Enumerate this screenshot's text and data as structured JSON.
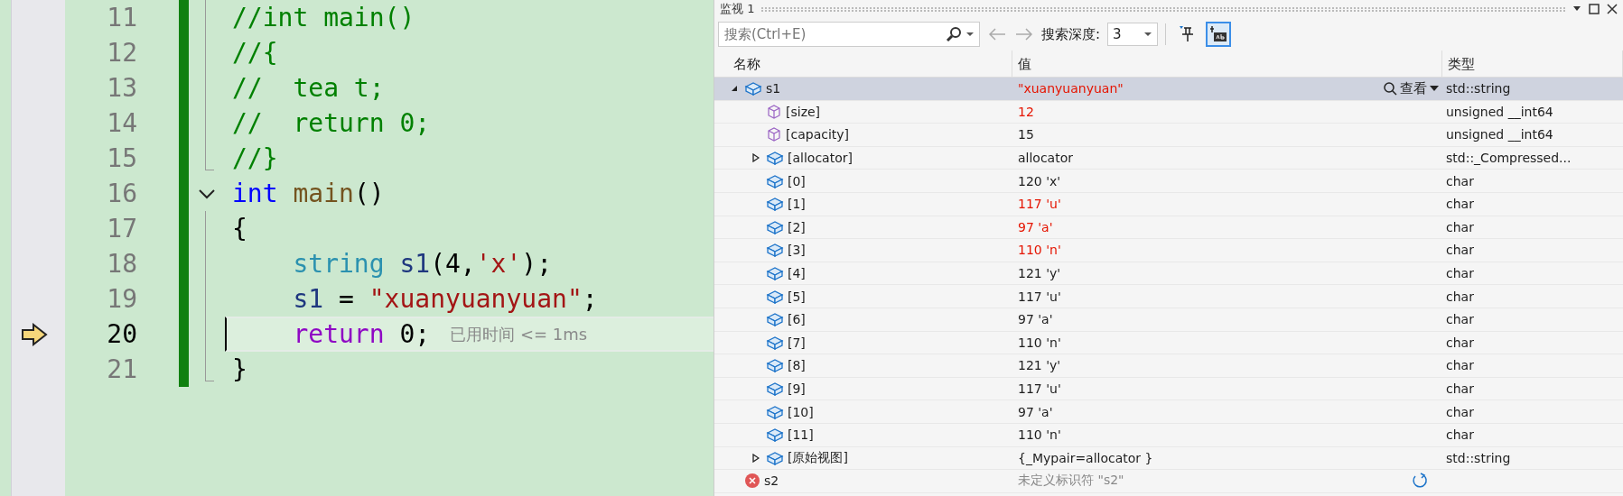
{
  "editor": {
    "lines": [
      {
        "number": "11",
        "current": false,
        "tokens": [
          {
            "kind": "comment",
            "text": "//int main()"
          }
        ]
      },
      {
        "number": "12",
        "current": false,
        "tokens": [
          {
            "kind": "comment",
            "text": "//{"
          }
        ]
      },
      {
        "number": "13",
        "current": false,
        "tokens": [
          {
            "kind": "comment",
            "text": "//  tea t;"
          }
        ]
      },
      {
        "number": "14",
        "current": false,
        "tokens": [
          {
            "kind": "comment",
            "text": "//  return 0;"
          }
        ]
      },
      {
        "number": "15",
        "current": false,
        "tokens": [
          {
            "kind": "comment",
            "text": "//}"
          }
        ]
      },
      {
        "number": "16",
        "current": false,
        "expanded": true,
        "tokens": [
          {
            "kind": "keyword",
            "text": "int"
          },
          {
            "kind": "function",
            "text": " main"
          },
          {
            "kind": "plain",
            "text": "()"
          }
        ]
      },
      {
        "number": "17",
        "current": false,
        "tokens": [
          {
            "kind": "plain",
            "text": "{"
          }
        ]
      },
      {
        "number": "18",
        "current": false,
        "tokens": [
          {
            "kind": "type",
            "text": "    string"
          },
          {
            "kind": "variable",
            "text": " s1"
          },
          {
            "kind": "plain",
            "text": "(4,"
          },
          {
            "kind": "string",
            "text": "'x'"
          },
          {
            "kind": "plain",
            "text": ");"
          }
        ]
      },
      {
        "number": "19",
        "current": false,
        "tokens": [
          {
            "kind": "variable",
            "text": "    s1"
          },
          {
            "kind": "plain",
            "text": " = "
          },
          {
            "kind": "string",
            "text": "\"xuanyuanyuan\""
          },
          {
            "kind": "plain",
            "text": ";"
          }
        ]
      },
      {
        "number": "20",
        "current": true,
        "hint": "已用时间 <= 1ms",
        "tokens": [
          {
            "kind": "control",
            "text": "    return"
          },
          {
            "kind": "plain",
            "text": " 0;"
          }
        ]
      },
      {
        "number": "21",
        "current": false,
        "tokens": [
          {
            "kind": "plain",
            "text": "}"
          }
        ]
      }
    ]
  },
  "watch": {
    "title": "监视 1",
    "search": {
      "placeholder": "搜索(Ctrl+E)"
    },
    "depth_label": "搜索深度:",
    "depth_value": "3",
    "toggles": [
      {
        "kind": "pin",
        "selected": false
      },
      {
        "kind": "raw",
        "selected": true
      }
    ],
    "columns": [
      "名称",
      "值",
      "类型"
    ],
    "rows": [
      {
        "kind": "object",
        "name": "s1",
        "value": "\"xuanyuanyuan\"",
        "changed": true,
        "type": "std::string",
        "selected": true,
        "expanded": true,
        "view_label": "查看",
        "children": [
          {
            "kind": "member",
            "name": "[size]",
            "value": "12",
            "changed": true,
            "type": "unsigned __int64",
            "selected": false
          },
          {
            "kind": "member",
            "name": "[capacity]",
            "value": "15",
            "changed": false,
            "type": "unsigned __int64",
            "selected": false
          },
          {
            "kind": "object",
            "name": "[allocator]",
            "value": "allocator",
            "changed": false,
            "type": "std::_Compressed...",
            "selected": false,
            "expanded": false
          },
          {
            "kind": "object",
            "name": "[0]",
            "value": "120 'x'",
            "changed": false,
            "type": "char",
            "selected": false
          },
          {
            "kind": "object",
            "name": "[1]",
            "value": "117 'u'",
            "changed": true,
            "type": "char",
            "selected": false
          },
          {
            "kind": "object",
            "name": "[2]",
            "value": "97 'a'",
            "changed": true,
            "type": "char",
            "selected": false
          },
          {
            "kind": "object",
            "name": "[3]",
            "value": "110 'n'",
            "changed": true,
            "type": "char",
            "selected": false
          },
          {
            "kind": "object",
            "name": "[4]",
            "value": "121 'y'",
            "changed": false,
            "type": "char",
            "selected": false
          },
          {
            "kind": "object",
            "name": "[5]",
            "value": "117 'u'",
            "changed": false,
            "type": "char",
            "selected": false
          },
          {
            "kind": "object",
            "name": "[6]",
            "value": "97 'a'",
            "changed": false,
            "type": "char",
            "selected": false
          },
          {
            "kind": "object",
            "name": "[7]",
            "value": "110 'n'",
            "changed": false,
            "type": "char",
            "selected": false
          },
          {
            "kind": "object",
            "name": "[8]",
            "value": "121 'y'",
            "changed": false,
            "type": "char",
            "selected": false
          },
          {
            "kind": "object",
            "name": "[9]",
            "value": "117 'u'",
            "changed": false,
            "type": "char",
            "selected": false
          },
          {
            "kind": "object",
            "name": "[10]",
            "value": "97 'a'",
            "changed": false,
            "type": "char",
            "selected": false
          },
          {
            "kind": "object",
            "name": "[11]",
            "value": "110 'n'",
            "changed": false,
            "type": "char",
            "selected": false
          },
          {
            "kind": "object",
            "name": "[原始视图]",
            "value": "{_Mypair=allocator }",
            "changed": false,
            "type": "std::string",
            "selected": false,
            "expanded": false
          }
        ]
      },
      {
        "kind": "error",
        "name": "s2",
        "value": "未定义标识符 \"s2\"",
        "selected": false,
        "refresh": true
      }
    ]
  }
}
